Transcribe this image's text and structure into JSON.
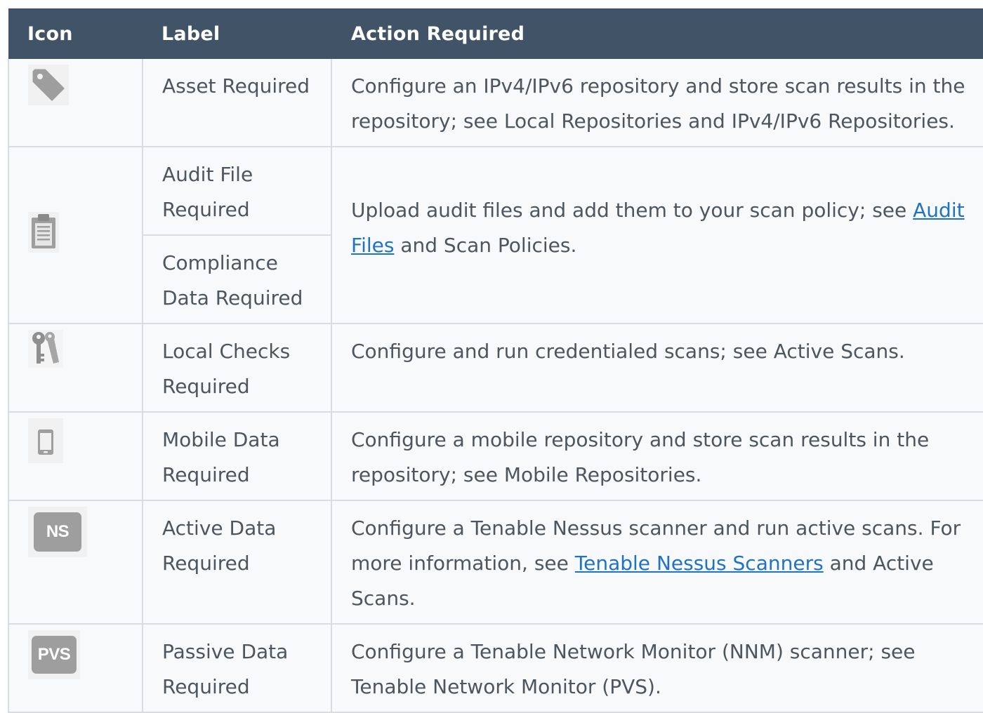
{
  "header": {
    "icon": "Icon",
    "label": "Label",
    "action": "Action Required"
  },
  "rows": {
    "asset": {
      "icon": "tag-icon",
      "label": "Asset Required",
      "action": "Configure an IPv4/IPv6 repository and store scan results in the repository; see Local Repositories and IPv4/IPv6 Repositories."
    },
    "audit": {
      "icon": "clipboard-icon",
      "label": "Audit File Required",
      "label2": "Compliance Data Required",
      "action_before": "Upload audit files and add them to your scan policy; see ",
      "action_link": "Audit Files",
      "action_after": " and Scan Policies."
    },
    "local": {
      "icon": "keys-icon",
      "label": "Local Checks Required",
      "action": "Configure and run credentialed scans; see Active Scans."
    },
    "mobile": {
      "icon": "mobile-phone-icon",
      "label": "Mobile Data Required",
      "action": "Configure a mobile repository and store scan results in the repository; see Mobile Repositories."
    },
    "active": {
      "icon": "ns-icon",
      "icon_text": "NS",
      "label": "Active Data Required",
      "action_before": "Configure a Tenable Nessus scanner and run active scans. For more information, see ",
      "action_link": "Tenable Nessus Scanners",
      "action_after": " and Active Scans."
    },
    "passive": {
      "icon": "pvs-icon",
      "icon_text": "PVS",
      "label": "Passive Data Required",
      "action": "Configure a Tenable Network Monitor (NNM) scanner; see Tenable Network Monitor (PVS)."
    }
  },
  "colors": {
    "header_bg": "#415366",
    "row_bg": "#f8f9fa",
    "border": "#dadde0",
    "text": "#4d565e",
    "link": "#1f73c6",
    "icon_gray": "#9e9e9e"
  }
}
